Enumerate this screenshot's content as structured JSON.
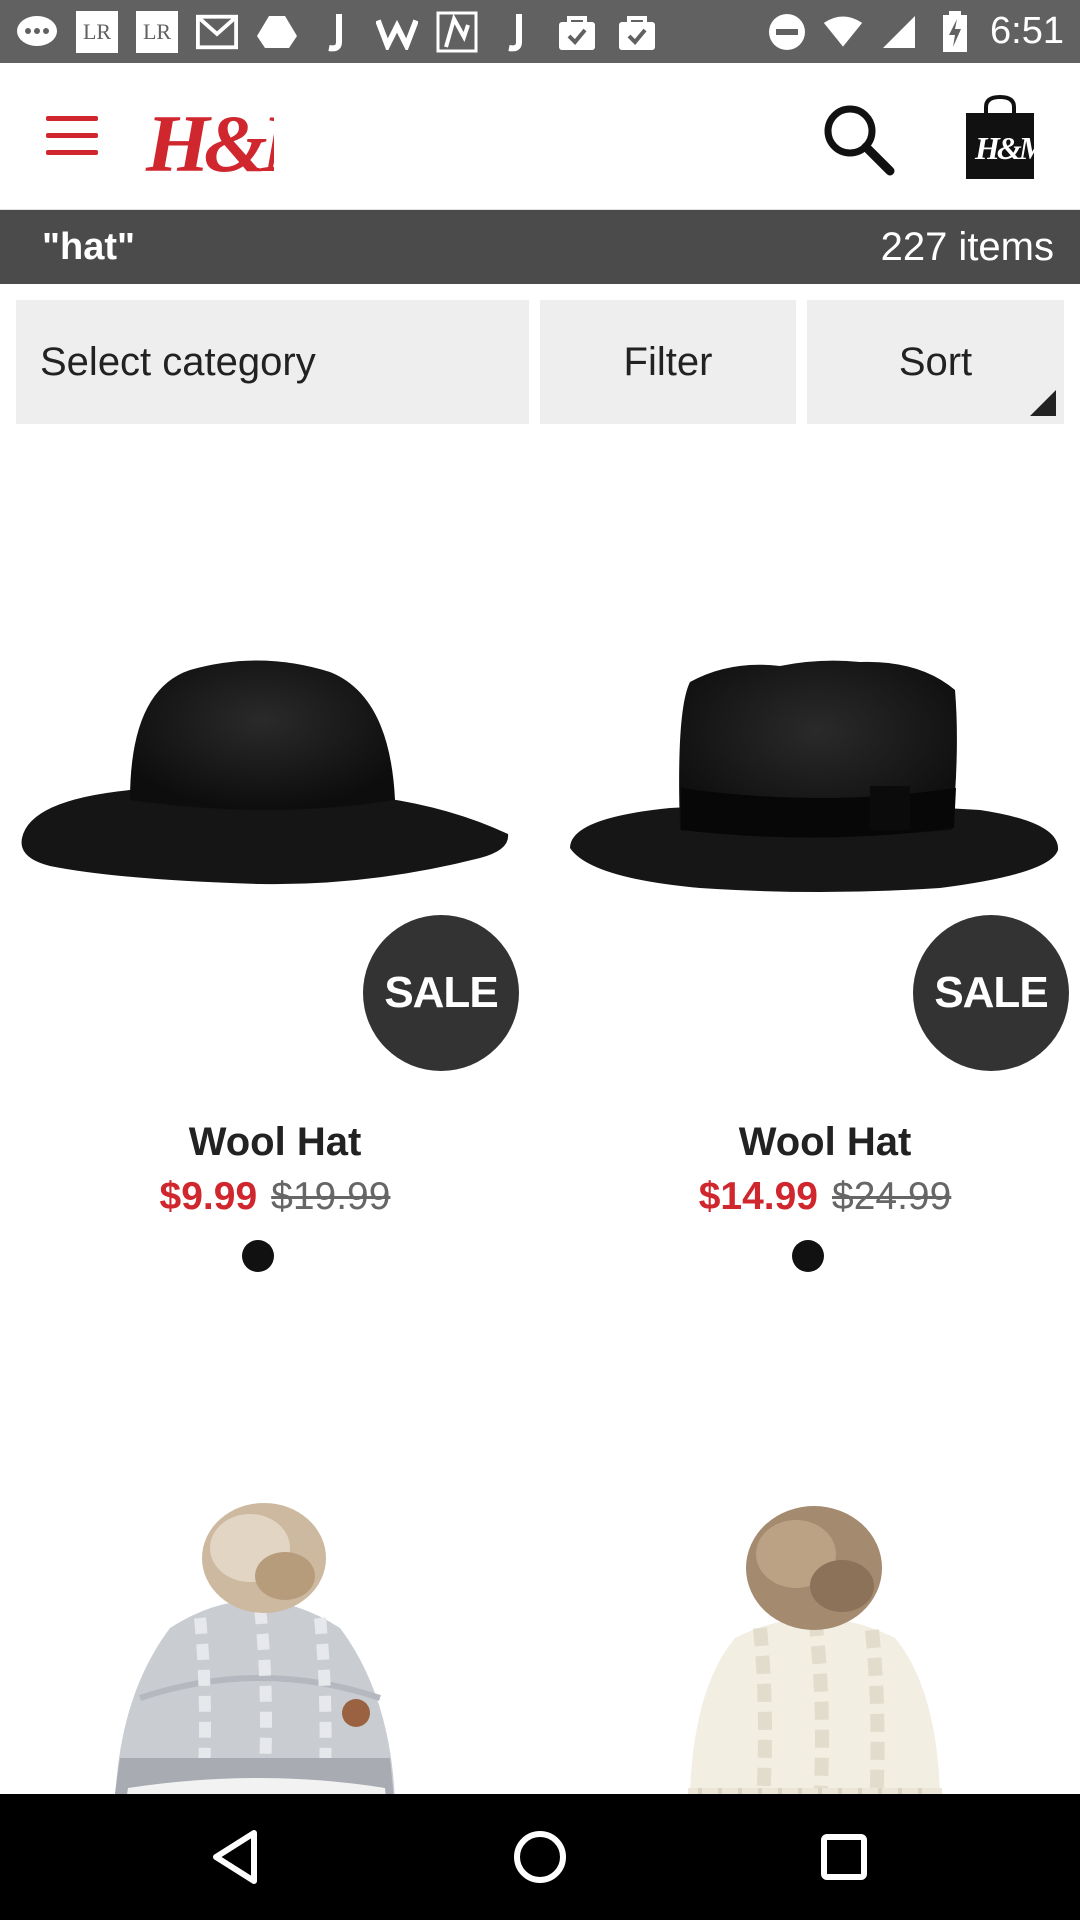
{
  "status_bar": {
    "time": "6:51",
    "icons": [
      "messenger-icon",
      "lr-icon",
      "lr-icon",
      "gmail-icon",
      "drive-icon",
      "j-icon",
      "w-icon",
      "map-icon",
      "j-icon",
      "shopping-bag-icon",
      "shopping-bag-icon",
      "do-not-disturb-icon",
      "wifi-icon",
      "signal-icon",
      "battery-charging-icon"
    ],
    "lr_label": "LR"
  },
  "app_bar": {
    "logo_text": "H&M",
    "bag_logo_text": "H&M",
    "brand_color": "#d0262d"
  },
  "search_header": {
    "query": "\"hat\"",
    "count": "227 items"
  },
  "controls": {
    "category": "Select category",
    "filter": "Filter",
    "sort": "Sort"
  },
  "products": [
    {
      "name": "Wool Hat",
      "sale_price": "$9.99",
      "original_price": "$19.99",
      "badge": "SALE",
      "swatch_color": "#111111"
    },
    {
      "name": "Wool Hat",
      "sale_price": "$14.99",
      "original_price": "$24.99",
      "badge": "SALE",
      "swatch_color": "#111111"
    }
  ],
  "partial_products": [
    {
      "image": "grey-knit-pompom-hat"
    },
    {
      "image": "cream-knit-pompom-hat"
    }
  ],
  "nav_bar": {
    "buttons": [
      "back-icon",
      "home-icon",
      "recents-icon"
    ]
  }
}
